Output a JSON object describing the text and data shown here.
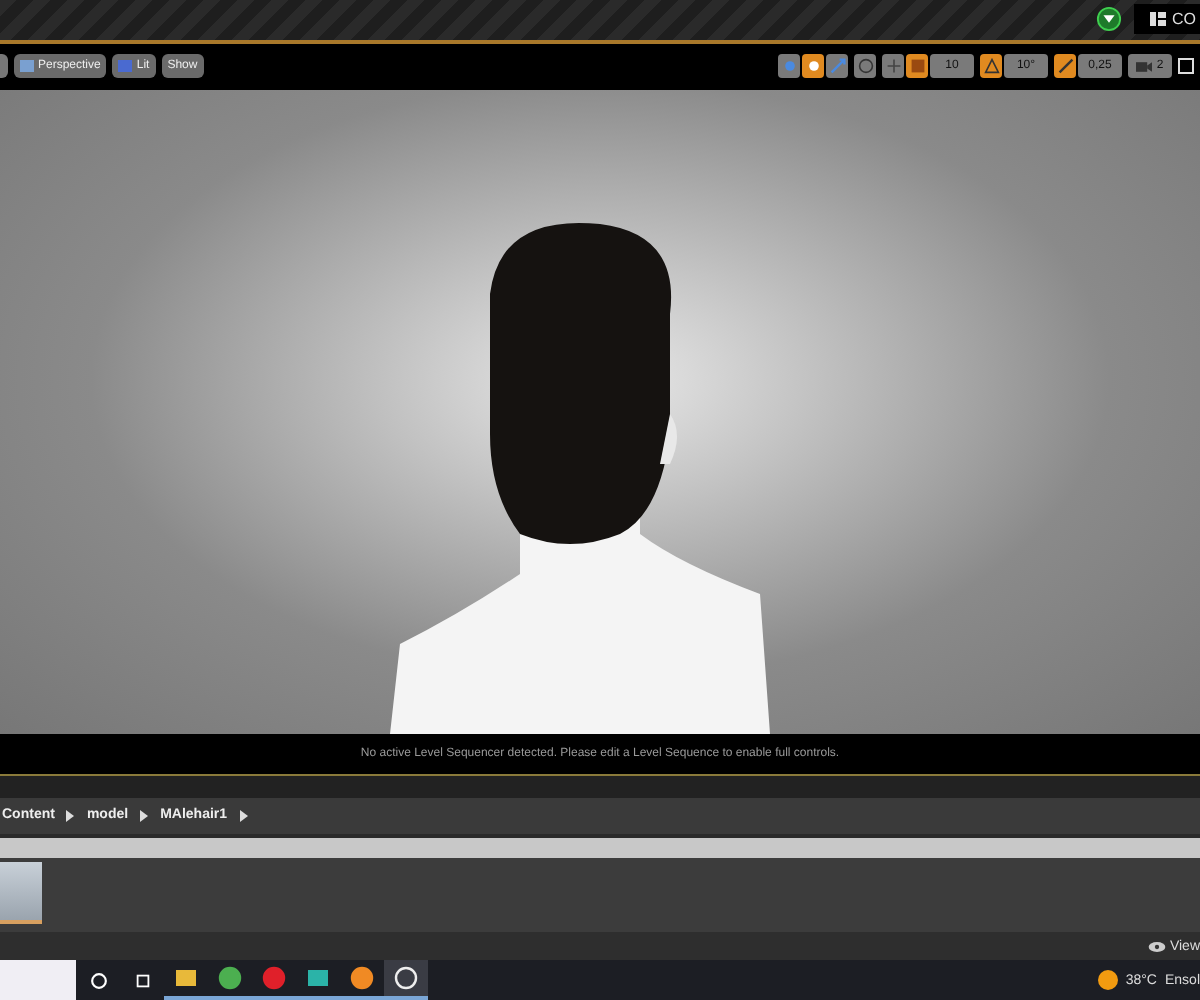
{
  "title_bar": {
    "account_label": "CO"
  },
  "viewport_toolbar": {
    "view_buttons": [
      {
        "kind": "perspective",
        "label": "Perspective"
      },
      {
        "kind": "lit",
        "label": "Lit"
      },
      {
        "kind": "plain",
        "label": "Show"
      }
    ],
    "transform_modes": [
      {
        "kind": "move",
        "selected": false
      },
      {
        "kind": "rotate",
        "selected": true
      },
      {
        "kind": "scale",
        "selected": false
      }
    ],
    "snaps": [
      {
        "kind": "grid",
        "on": true,
        "value": "10"
      },
      {
        "kind": "rotation",
        "on": true,
        "value": "10°"
      },
      {
        "kind": "scale",
        "on": true,
        "value": "0,25"
      }
    ],
    "camera_speed": "2"
  },
  "viewport": {
    "message": "No active Level Sequencer detected. Please edit a Level Sequence to enable full controls."
  },
  "breadcrumb": [
    "Content",
    "model",
    "MAlehair1"
  ],
  "content_browser": {
    "view_options": "View"
  },
  "taskbar": {
    "apps": [
      {
        "kind": "folder",
        "selected": false
      },
      {
        "kind": "chrome",
        "selected": false
      },
      {
        "kind": "opera",
        "selected": false
      },
      {
        "kind": "m",
        "selected": false
      },
      {
        "kind": "blender",
        "selected": false
      },
      {
        "kind": "unreal",
        "selected": true
      }
    ],
    "temperature": "38°C",
    "weather": "Ensol"
  }
}
